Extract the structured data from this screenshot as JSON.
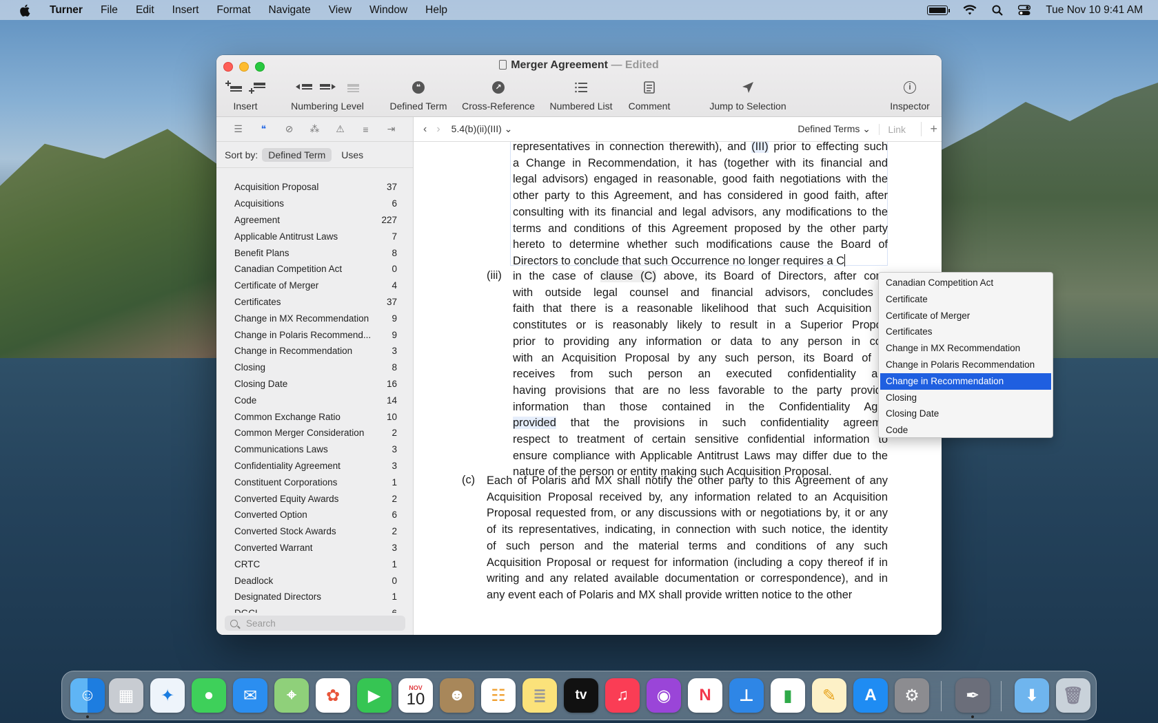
{
  "menubar": {
    "app": "Turner",
    "items": [
      "File",
      "Edit",
      "Insert",
      "Format",
      "Navigate",
      "View",
      "Window",
      "Help"
    ],
    "clock": "Tue Nov 10  9:41 AM"
  },
  "window": {
    "title": "Merger Agreement",
    "edited": "Edited",
    "title_sep": "—"
  },
  "toolbar": {
    "insert": "Insert",
    "numbering_level": "Numbering Level",
    "defined_term": "Defined Term",
    "cross_reference": "Cross-Reference",
    "numbered_list": "Numbered List",
    "comment": "Comment",
    "jump_to_selection": "Jump to Selection",
    "inspector": "Inspector"
  },
  "sidebar": {
    "sort_by": "Sort by:",
    "sort_defined_term": "Defined Term",
    "sort_uses": "Uses",
    "search_placeholder": "Search",
    "terms": [
      {
        "name": "Acquisition Proposal",
        "count": "37"
      },
      {
        "name": "Acquisitions",
        "count": "6"
      },
      {
        "name": "Agreement",
        "count": "227"
      },
      {
        "name": "Applicable Antitrust Laws",
        "count": "7"
      },
      {
        "name": "Benefit Plans",
        "count": "8"
      },
      {
        "name": "Canadian Competition Act",
        "count": "0"
      },
      {
        "name": "Certificate of Merger",
        "count": "4"
      },
      {
        "name": "Certificates",
        "count": "37"
      },
      {
        "name": "Change in MX Recommendation",
        "count": "9"
      },
      {
        "name": "Change in Polaris Recommend...",
        "count": "9"
      },
      {
        "name": "Change in Recommendation",
        "count": "3"
      },
      {
        "name": "Closing",
        "count": "8"
      },
      {
        "name": "Closing Date",
        "count": "16"
      },
      {
        "name": "Code",
        "count": "14"
      },
      {
        "name": "Common Exchange Ratio",
        "count": "10"
      },
      {
        "name": "Common Merger Consideration",
        "count": "2"
      },
      {
        "name": "Communications Laws",
        "count": "3"
      },
      {
        "name": "Confidentiality Agreement",
        "count": "3"
      },
      {
        "name": "Constituent Corporations",
        "count": "1"
      },
      {
        "name": "Converted Equity Awards",
        "count": "2"
      },
      {
        "name": "Converted Option",
        "count": "6"
      },
      {
        "name": "Converted Stock Awards",
        "count": "2"
      },
      {
        "name": "Converted Warrant",
        "count": "3"
      },
      {
        "name": "CRTC",
        "count": "1"
      },
      {
        "name": "Deadlock",
        "count": "0"
      },
      {
        "name": "Designated Directors",
        "count": "1"
      },
      {
        "name": "DGCL",
        "count": "6"
      }
    ]
  },
  "navbar": {
    "path": "5.4(b)(ii)(III)",
    "defined_terms": "Defined Terms",
    "link": "Link"
  },
  "document": {
    "para1": [
      {
        "pre": "representatives in connection therewith), and ",
        "hl": "(III)",
        "post": " prior to effecting such"
      },
      {
        "text": "a Change in Recommendation, it has (together with its financial and"
      },
      {
        "text": "legal advisors) engaged in reasonable, good faith negotiations with the"
      },
      {
        "text": "other party to this Agreement, and has considered in good faith, after"
      },
      {
        "text": "consulting with its financial and legal advisors, any modifications to the"
      },
      {
        "text": "terms and conditions of this Agreement proposed by the other party"
      },
      {
        "text": "hereto to determine whether such modifications cause the Board of"
      },
      {
        "text": "Directors to conclude that such Occurrence no longer requires a C"
      }
    ],
    "marker_iii": "(iii)",
    "para2": [
      {
        "pre": "in the case of ",
        "hl": "clause (C)",
        "post": " above, its Board of Directors, after cons"
      },
      {
        "text": "with outside legal counsel and financial advisors, concludes i"
      },
      {
        "text": "faith that there is a reasonable likelihood that such Acquisition P"
      },
      {
        "text": "constitutes or is reasonably likely to result in a Superior Propos"
      },
      {
        "text": "prior to providing any information or data to any person in con"
      },
      {
        "text": "with an Acquisition Proposal by any such person, its Board of D"
      },
      {
        "text": "receives from such person an executed confidentiality agr"
      },
      {
        "text": "having provisions that are no less favorable to the party providir"
      },
      {
        "text": "information than those contained in the Confidentiality Agre"
      },
      {
        "pre": "",
        "hl": "provided",
        "post": " that the provisions in such confidentiality agreeme"
      },
      {
        "text": "respect to treatment of certain sensitive confidential information to"
      },
      {
        "text": "ensure compliance with Applicable Antitrust Laws may differ due to the"
      },
      {
        "text": "nature of the person or entity making such Acquisition Proposal."
      }
    ],
    "marker_c": "(c)",
    "para3": [
      {
        "text": "Each of Polaris and MX shall notify the other party to this Agreement of any"
      },
      {
        "text": "Acquisition Proposal received by, any information related to an Acquisition"
      },
      {
        "text": "Proposal requested from, or any discussions with or negotiations by, it or any"
      },
      {
        "text": "of its representatives, indicating, in connection with such notice, the identity"
      },
      {
        "text": "of such person and the material terms and conditions of any such"
      },
      {
        "text": "Acquisition Proposal or request for information (including a copy thereof if in"
      },
      {
        "text": "writing and any related available documentation or correspondence), and in"
      },
      {
        "text": "any event each of Polaris and MX shall provide written notice to the other"
      }
    ]
  },
  "autocomplete": {
    "options": [
      "Canadian Competition Act",
      "Certificate",
      "Certificate of Merger",
      "Certificates",
      "Change in MX Recommendation",
      "Change in Polaris Recommendation",
      "Change in Recommendation",
      "Closing",
      "Closing Date",
      "Code"
    ],
    "selected": "Change in Recommendation"
  },
  "dock": {
    "calendar_month": "NOV",
    "calendar_day": "10",
    "tv_label": "tv"
  },
  "colors": {
    "accent": "#1f5fe0",
    "defined_term_highlight": "#e6eefb"
  }
}
